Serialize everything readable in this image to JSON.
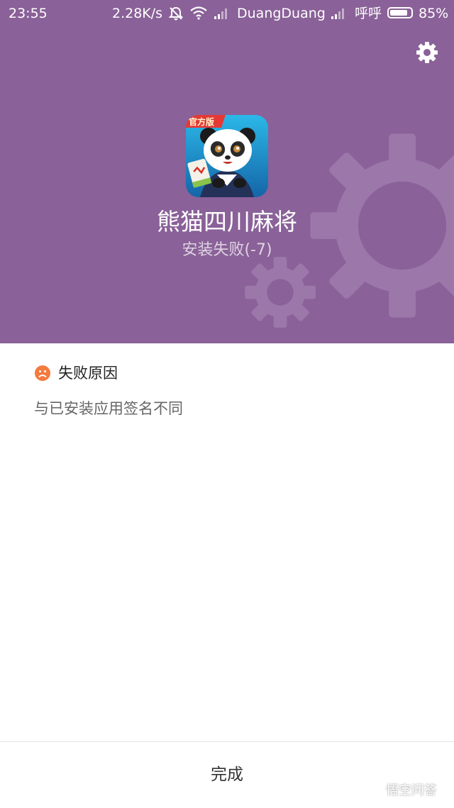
{
  "status_bar": {
    "time": "23:55",
    "speed": "2.28K/s",
    "carrier1": "DuangDuang",
    "carrier2": "呼呼",
    "battery": "85%",
    "battery_level": 0.85
  },
  "header": {
    "app_name": "熊猫四川麻将",
    "install_status": "安装失败(-7)",
    "icon_badge": "官方版",
    "background_color": "#8a6198"
  },
  "failure": {
    "title": "失败原因",
    "reason": "与已安装应用签名不同"
  },
  "footer": {
    "done_label": "完成"
  },
  "watermark": {
    "text": "悟空问答"
  },
  "icons": [
    "gear-icon",
    "sad-face-icon",
    "wifi-icon",
    "signal-icon",
    "alarm-off-icon",
    "battery-icon"
  ]
}
